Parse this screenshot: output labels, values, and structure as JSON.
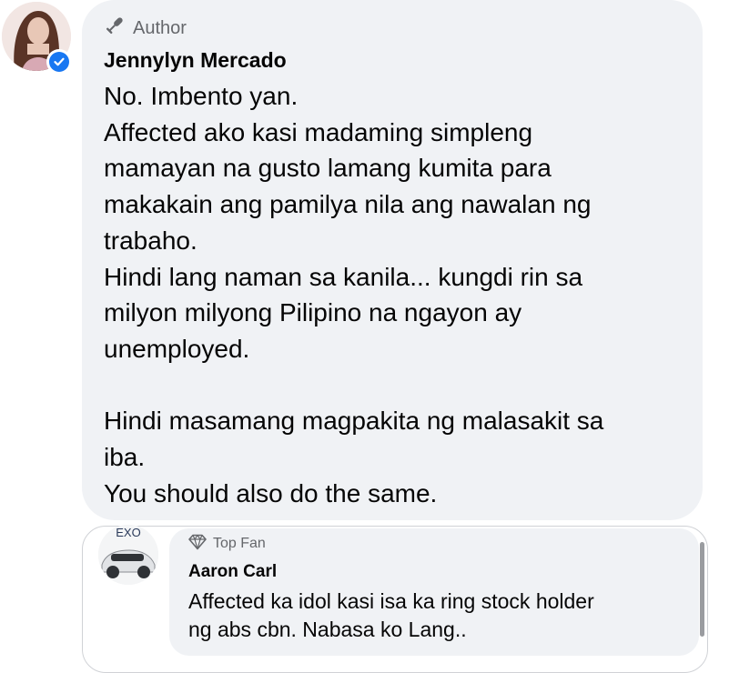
{
  "main_comment": {
    "badge": "Author",
    "author": "Jennylyn Mercado",
    "lines": [
      "No. Imbento yan.",
      "Affected ako kasi madaming simpleng",
      "mamayan na gusto lamang kumita para",
      "makakain ang pamilya nila ang nawalan ng",
      "trabaho.",
      "Hindi lang naman sa kanila... kungdi rin sa",
      "milyon milyong Pilipino na ngayon ay",
      "unemployed.",
      "",
      "Hindi masamang magpakita ng malasakit sa",
      "iba.",
      "You should also do the same."
    ]
  },
  "reply": {
    "avatar_text": "EXO",
    "badge": "Top Fan",
    "author": "Aaron Carl",
    "lines": [
      "Affected ka idol kasi isa ka ring stock holder",
      "ng abs cbn. Nabasa ko Lang.."
    ]
  },
  "icons": {
    "author_badge": "microphone-icon",
    "verified": "verified-check-icon",
    "top_fan_badge": "diamond-icon"
  },
  "colors": {
    "bubble": "#f0f2f5",
    "text": "#050505",
    "secondary_text": "#65676b",
    "verified_blue": "#1877f2"
  }
}
